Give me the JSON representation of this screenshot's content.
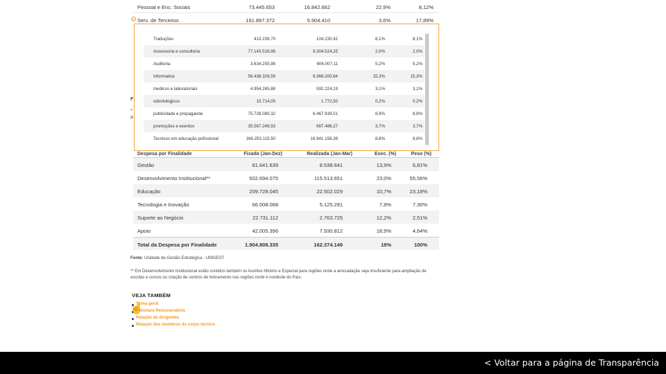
{
  "top_table": {
    "rows": [
      {
        "name": "Pessoal e Enc. Sociais",
        "fixada": "73.445.653",
        "realizada": "16.842.662",
        "exec": "22,9%",
        "peso": "8,12%"
      },
      {
        "name": "Serv. de Terceiros",
        "fixada": "161.897.372",
        "realizada": "5.904.410",
        "exec": "3,6%",
        "peso": "17,89%"
      }
    ]
  },
  "fragments": {
    "f1": "F",
    "f2": "*",
    "f3": "a"
  },
  "popup": {
    "rows": [
      {
        "name": "Traduções",
        "fixada": "413.239,70",
        "realizada": "104.230,42",
        "exec": "8,1%",
        "peso": "8,1%"
      },
      {
        "name": "Assessoria e consultoria",
        "fixada": "77.143.518,96",
        "realizada": "9.304.524,25",
        "exec": "2,0%",
        "peso": "2,0%"
      },
      {
        "name": "Auditoria",
        "fixada": "3.634.255,98",
        "realizada": "606.007,11",
        "exec": "5,2%",
        "peso": "5,2%"
      },
      {
        "name": "Informatica",
        "fixada": "56.438.329,59",
        "realizada": "9.368.200,64",
        "exec": "15,3%",
        "peso": "15,3%"
      },
      {
        "name": "medicos e laboratoriais",
        "fixada": "4.954.265,88",
        "realizada": "592.224,19",
        "exec": "3,1%",
        "peso": "3,1%"
      },
      {
        "name": "odontologicos",
        "fixada": "10.714,05",
        "realizada": "1.772,50",
        "exec": "0,2%",
        "peso": "0,2%"
      },
      {
        "name": "publicidade e propaganda",
        "fixada": "75.728.080,32",
        "realizada": "6.467.939,01",
        "exec": "8,9%",
        "peso": "8,9%"
      },
      {
        "name": "promoções e eventos",
        "fixada": "35.567.249,93",
        "realizada": "987.486,27",
        "exec": "3,7%",
        "peso": "3,7%"
      },
      {
        "name": "Tecnicos em educação pofissional",
        "fixada": "166.253.115,50",
        "realizada": "16.941.158,39",
        "exec": "8,8%",
        "peso": "8,8%"
      }
    ]
  },
  "finalidade": {
    "headers": {
      "name": "Despesa por Finalidade",
      "fixada": "Fixada (Jan-Dez)",
      "realizada": "Realizada (Jan-Mar)",
      "exec": "Exec. (%)",
      "peso": "Peso (%)"
    },
    "rows": [
      {
        "name": "Gestão",
        "fixada": "61.641.639",
        "realizada": "8.538.641",
        "exec": "13,9%",
        "peso": "6,81%"
      },
      {
        "name": "Desenvolvimento Institucional**",
        "fixada": "502.694.075",
        "realizada": "115.513.651",
        "exec": "23,0%",
        "peso": "55,56%"
      },
      {
        "name": "Educação",
        "fixada": "209.728.045",
        "realizada": "22.502.029",
        "exec": "10,7%",
        "peso": "23,18%"
      },
      {
        "name": "Tecnologia e Inovação",
        "fixada": "66.008.068",
        "realizada": "5.125.291",
        "exec": "7,8%",
        "peso": "7,30%"
      },
      {
        "name": "Suporte ao Negócio",
        "fixada": "22.731.112",
        "realizada": "2.763.725",
        "exec": "12,2%",
        "peso": "2,51%"
      },
      {
        "name": "Apoio",
        "fixada": "42.005.396",
        "realizada": "7.930.812",
        "exec": "18,9%",
        "peso": "4,64%"
      }
    ],
    "total": {
      "name": "Total da Despesa por Finalidade",
      "fixada": "1.904.808.335",
      "realizada": "162.374.149",
      "exec": "18%",
      "peso": "100%"
    }
  },
  "fonte": {
    "label": "Fonte:",
    "text": " Unidade de Gestão Estratégica - UNIGEST"
  },
  "nota": "** Em Desenvolvimento Institucional estão contidos também os Auxílios Mínimo e Especial para regiões onde a arrecadação seja insuficiente para ampliação de escolas e cursos ou criação de centros de treinamento nas regiões norte e nordeste do País.",
  "veja_tambem": {
    "title": "VEJA TAMBÉM",
    "links": [
      "Soma geral",
      "Estrutura Remuneratória",
      "Relação de dirigentes",
      "Relação dos membros do corpo técnico"
    ]
  },
  "bottom_bar": {
    "back_label": "< Voltar para a página de Transparência"
  }
}
